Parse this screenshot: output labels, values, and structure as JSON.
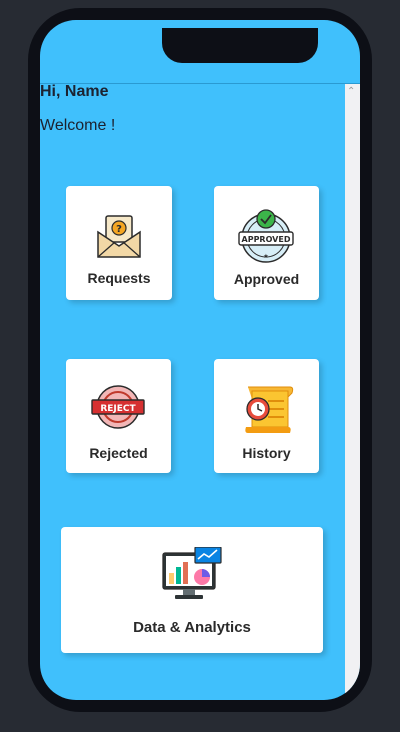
{
  "greeting": "Hi, Name",
  "welcome": "Welcome !",
  "cards": {
    "requests": "Requests",
    "approved": "Approved",
    "rejected": "Rejected",
    "history": "History",
    "analytics": "Data & Analytics"
  },
  "badges": {
    "approved_stamp": "APPROVED",
    "rejected_stamp": "REJECT"
  },
  "icons": {
    "requests": "envelope-question-icon",
    "approved": "approved-stamp-icon",
    "rejected": "reject-stamp-icon",
    "history": "history-scroll-clock-icon",
    "analytics": "monitor-charts-icon"
  },
  "colors": {
    "screen_bg": "#40c0fc",
    "card_bg": "#ffffff",
    "phone_frame": "#0d0f16"
  }
}
